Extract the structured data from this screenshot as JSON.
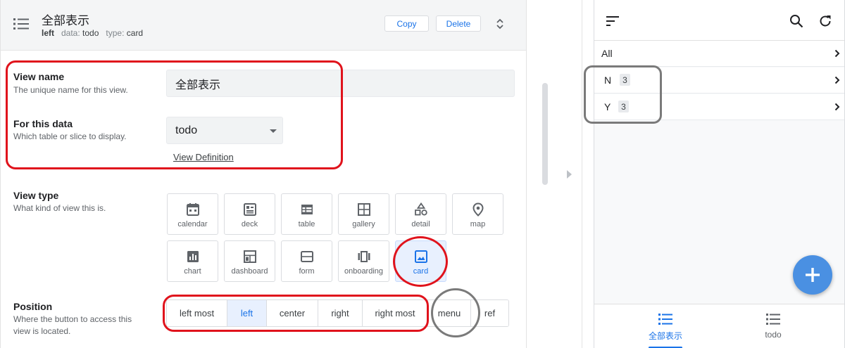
{
  "header": {
    "title": "全部表示",
    "position": "left",
    "data_label": "data:",
    "data_value": "todo",
    "type_label": "type:",
    "type_value": "card",
    "copy_label": "Copy",
    "delete_label": "Delete"
  },
  "view_name": {
    "title": "View name",
    "description": "The unique name for this view.",
    "value": "全部表示"
  },
  "for_data": {
    "title": "For this data",
    "description": "Which table or slice to display.",
    "value": "todo",
    "view_definition_link": "View Definition"
  },
  "view_type": {
    "title": "View type",
    "description": "What kind of view this is.",
    "selected": "card",
    "tiles": [
      {
        "label": "calendar",
        "icon": "calendar-icon"
      },
      {
        "label": "deck",
        "icon": "deck-icon"
      },
      {
        "label": "table",
        "icon": "table-icon"
      },
      {
        "label": "gallery",
        "icon": "gallery-icon"
      },
      {
        "label": "detail",
        "icon": "detail-icon"
      },
      {
        "label": "map",
        "icon": "map-pin-icon"
      },
      {
        "label": "chart",
        "icon": "chart-icon"
      },
      {
        "label": "dashboard",
        "icon": "dashboard-icon"
      },
      {
        "label": "form",
        "icon": "form-icon"
      },
      {
        "label": "onboarding",
        "icon": "onboarding-icon"
      },
      {
        "label": "card",
        "icon": "image-icon"
      }
    ]
  },
  "position": {
    "title": "Position",
    "description_line1": "Where the button to access this",
    "description_line2": "view is located.",
    "selected": "left",
    "options": [
      "left most",
      "left",
      "center",
      "right",
      "right most",
      "menu",
      "ref"
    ]
  },
  "preview": {
    "rows": [
      {
        "label": "All",
        "count": ""
      },
      {
        "label": "N",
        "count": "3"
      },
      {
        "label": "Y",
        "count": "3"
      }
    ],
    "nav": [
      {
        "label": "全部表示",
        "active": true
      },
      {
        "label": "todo",
        "active": false
      }
    ]
  },
  "colors": {
    "accent": "#1a73e8",
    "annotation_red": "#e0131c",
    "annotation_gray": "#7a7a7a",
    "fab": "#4a90e2"
  }
}
